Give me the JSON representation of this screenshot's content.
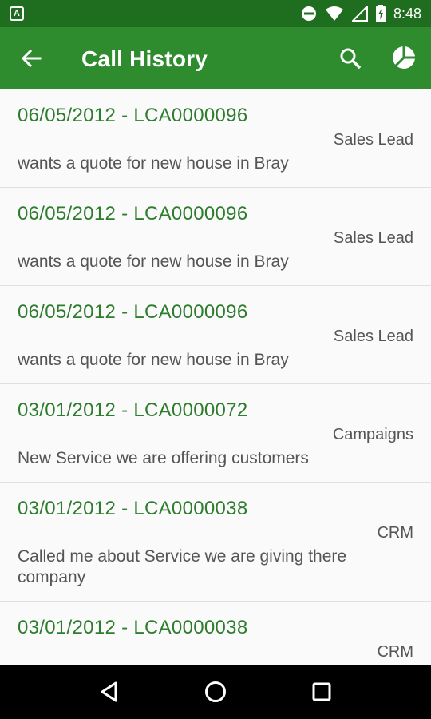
{
  "status_bar": {
    "time": "8:48",
    "left_icon_letter": "A"
  },
  "app_bar": {
    "title": "Call History"
  },
  "calls": [
    {
      "header": "06/05/2012 - LCA0000096",
      "category": "Sales Lead",
      "description": "wants a quote for new house in Bray"
    },
    {
      "header": "06/05/2012 - LCA0000096",
      "category": "Sales Lead",
      "description": "wants a quote for new house in Bray"
    },
    {
      "header": "06/05/2012 - LCA0000096",
      "category": "Sales Lead",
      "description": "wants a quote for new house in Bray"
    },
    {
      "header": "03/01/2012 - LCA0000072",
      "category": "Campaigns",
      "description": "New Service we are offering customers"
    },
    {
      "header": "03/01/2012 - LCA0000038",
      "category": "CRM",
      "description": "Called me about Service we are giving there company"
    },
    {
      "header": "03/01/2012 - LCA0000038",
      "category": "CRM",
      "description": ""
    }
  ],
  "colors": {
    "primary": "#2e8b2e",
    "primary_dark": "#1f6e1f",
    "accent_text": "#2e7d2e"
  },
  "icons": {
    "back": "arrow-left-icon",
    "search": "search-icon",
    "chart": "pie-chart-icon",
    "nav_back": "triangle-back-icon",
    "nav_home": "circle-home-icon",
    "nav_recents": "square-recents-icon"
  }
}
